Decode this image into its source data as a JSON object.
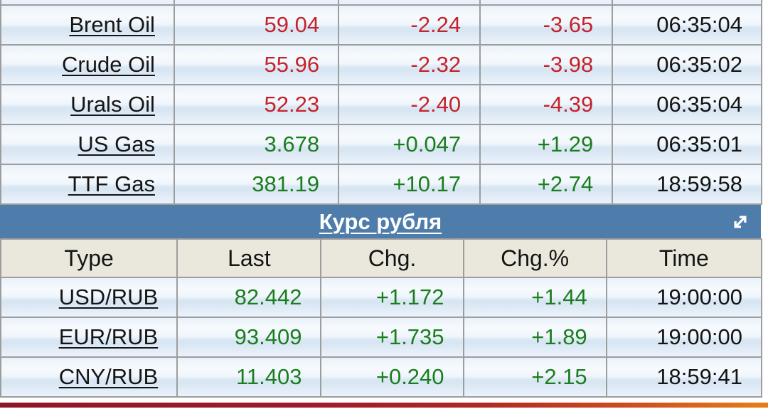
{
  "colors": {
    "negative": "#c5232b",
    "positive": "#1b7e1e",
    "section_header_bg": "#4e7cab",
    "header_row_bg": "#eae8dc",
    "bottom_bar_left": "#8f1626",
    "bottom_bar_right": "#e67e17"
  },
  "icons": {
    "expand": "diagonal-resize-arrows"
  },
  "commodities": {
    "rows": [
      {
        "name": "Brent Oil",
        "last": "59.04",
        "chg": "-2.24",
        "chg_pct": "-3.65",
        "time": "06:35:04",
        "trend": "down"
      },
      {
        "name": "Crude Oil",
        "last": "55.96",
        "chg": "-2.32",
        "chg_pct": "-3.98",
        "time": "06:35:02",
        "trend": "down"
      },
      {
        "name": "Urals Oil",
        "last": "52.23",
        "chg": "-2.40",
        "chg_pct": "-4.39",
        "time": "06:35:04",
        "trend": "down"
      },
      {
        "name": "US Gas",
        "last": "3.678",
        "chg": "+0.047",
        "chg_pct": "+1.29",
        "time": "06:35:01",
        "trend": "up"
      },
      {
        "name": "TTF Gas",
        "last": "381.19",
        "chg": "+10.17",
        "chg_pct": "+2.74",
        "time": "18:59:58",
        "trend": "up"
      }
    ]
  },
  "ruble": {
    "title": "Курс рубля",
    "headers": {
      "type": "Type",
      "last": "Last",
      "chg": "Chg.",
      "chg_pct": "Chg.%",
      "time": "Time"
    },
    "rows": [
      {
        "name": "USD/RUB",
        "last": "82.442",
        "chg": "+1.172",
        "chg_pct": "+1.44",
        "time": "19:00:00",
        "trend": "up"
      },
      {
        "name": "EUR/RUB",
        "last": "93.409",
        "chg": "+1.735",
        "chg_pct": "+1.89",
        "time": "19:00:00",
        "trend": "up"
      },
      {
        "name": "CNY/RUB",
        "last": "11.403",
        "chg": "+0.240",
        "chg_pct": "+2.15",
        "time": "18:59:41",
        "trend": "up"
      }
    ]
  }
}
